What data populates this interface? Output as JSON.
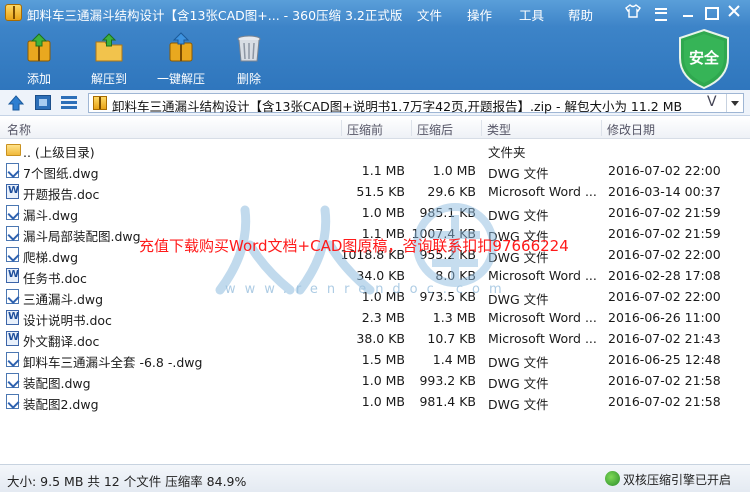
{
  "window": {
    "title": "卸料车三通漏斗结构设计【含13张CAD图+... - 360压缩 3.2正式版"
  },
  "menu": {
    "file": "文件",
    "operation": "操作",
    "tools": "工具",
    "help": "帮助"
  },
  "toolbar": {
    "add": "添加",
    "extract": "解压到",
    "one_click_extract": "一键解压",
    "delete": "删除"
  },
  "security": {
    "label": "安全",
    "color": "#2fa84f"
  },
  "address": {
    "path": "卸料车三通漏斗结构设计【含13张CAD图+说明书1.7万字42页,开题报告】.zip - 解包大小为 11.2 MB",
    "v_mark": "V"
  },
  "columns": {
    "name": "名称",
    "compressed": "压缩前",
    "original": "压缩后",
    "type": "类型",
    "modified": "修改日期"
  },
  "files": [
    {
      "name": ".. (上级目录)",
      "compressed": "",
      "original": "",
      "type": "文件夹",
      "modified": "",
      "icon": "folder"
    },
    {
      "name": "7个图纸.dwg",
      "compressed": "1.1 MB",
      "original": "1.0 MB",
      "type": "DWG 文件",
      "modified": "2016-07-02 22:00",
      "icon": "dwg"
    },
    {
      "name": "开题报告.doc",
      "compressed": "51.5 KB",
      "original": "29.6 KB",
      "type": "Microsoft Word ...",
      "modified": "2016-03-14 00:37",
      "icon": "doc"
    },
    {
      "name": "漏斗.dwg",
      "compressed": "1.0 MB",
      "original": "985.1 KB",
      "type": "DWG 文件",
      "modified": "2016-07-02 21:59",
      "icon": "dwg"
    },
    {
      "name": "漏斗局部装配图.dwg",
      "compressed": "1.1 MB",
      "original": "1007.4 KB",
      "type": "DWG 文件",
      "modified": "2016-07-02 21:59",
      "icon": "dwg"
    },
    {
      "name": "爬梯.dwg",
      "compressed": "1018.8 KB",
      "original": "955.2 KB",
      "type": "DWG 文件",
      "modified": "2016-07-02 22:00",
      "icon": "dwg"
    },
    {
      "name": "任务书.doc",
      "compressed": "34.0 KB",
      "original": "8.0 KB",
      "type": "Microsoft Word ...",
      "modified": "2016-02-28 17:08",
      "icon": "doc"
    },
    {
      "name": "三通漏斗.dwg",
      "compressed": "1.0 MB",
      "original": "973.5 KB",
      "type": "DWG 文件",
      "modified": "2016-07-02 22:00",
      "icon": "dwg"
    },
    {
      "name": "设计说明书.doc",
      "compressed": "2.3 MB",
      "original": "1.3 MB",
      "type": "Microsoft Word ...",
      "modified": "2016-06-26 11:00",
      "icon": "doc"
    },
    {
      "name": "外文翻译.doc",
      "compressed": "38.0 KB",
      "original": "10.7 KB",
      "type": "Microsoft Word ...",
      "modified": "2016-07-02 21:43",
      "icon": "doc"
    },
    {
      "name": "卸料车三通漏斗全套 -6.8 -.dwg",
      "compressed": "1.5 MB",
      "original": "1.4 MB",
      "type": "DWG 文件",
      "modified": "2016-06-25 12:48",
      "icon": "dwg"
    },
    {
      "name": "装配图.dwg",
      "compressed": "1.0 MB",
      "original": "993.2 KB",
      "type": "DWG 文件",
      "modified": "2016-07-02 21:58",
      "icon": "dwg"
    },
    {
      "name": "装配图2.dwg",
      "compressed": "1.0 MB",
      "original": "981.4 KB",
      "type": "DWG 文件",
      "modified": "2016-07-02 21:58",
      "icon": "dwg"
    }
  ],
  "overlay": {
    "promo": "充值下载购买Word文档+CAD图原稿，咨询联系扣扣97666224",
    "watermark_url": "www.renrendoc.com"
  },
  "status": {
    "summary": "大小: 9.5 MB 共 12 个文件 压缩率 84.9%",
    "engine": "双核压缩引擎已开启"
  },
  "colors": {
    "title_band": "#3d84c8",
    "promo_text": "#ff1a1a"
  }
}
